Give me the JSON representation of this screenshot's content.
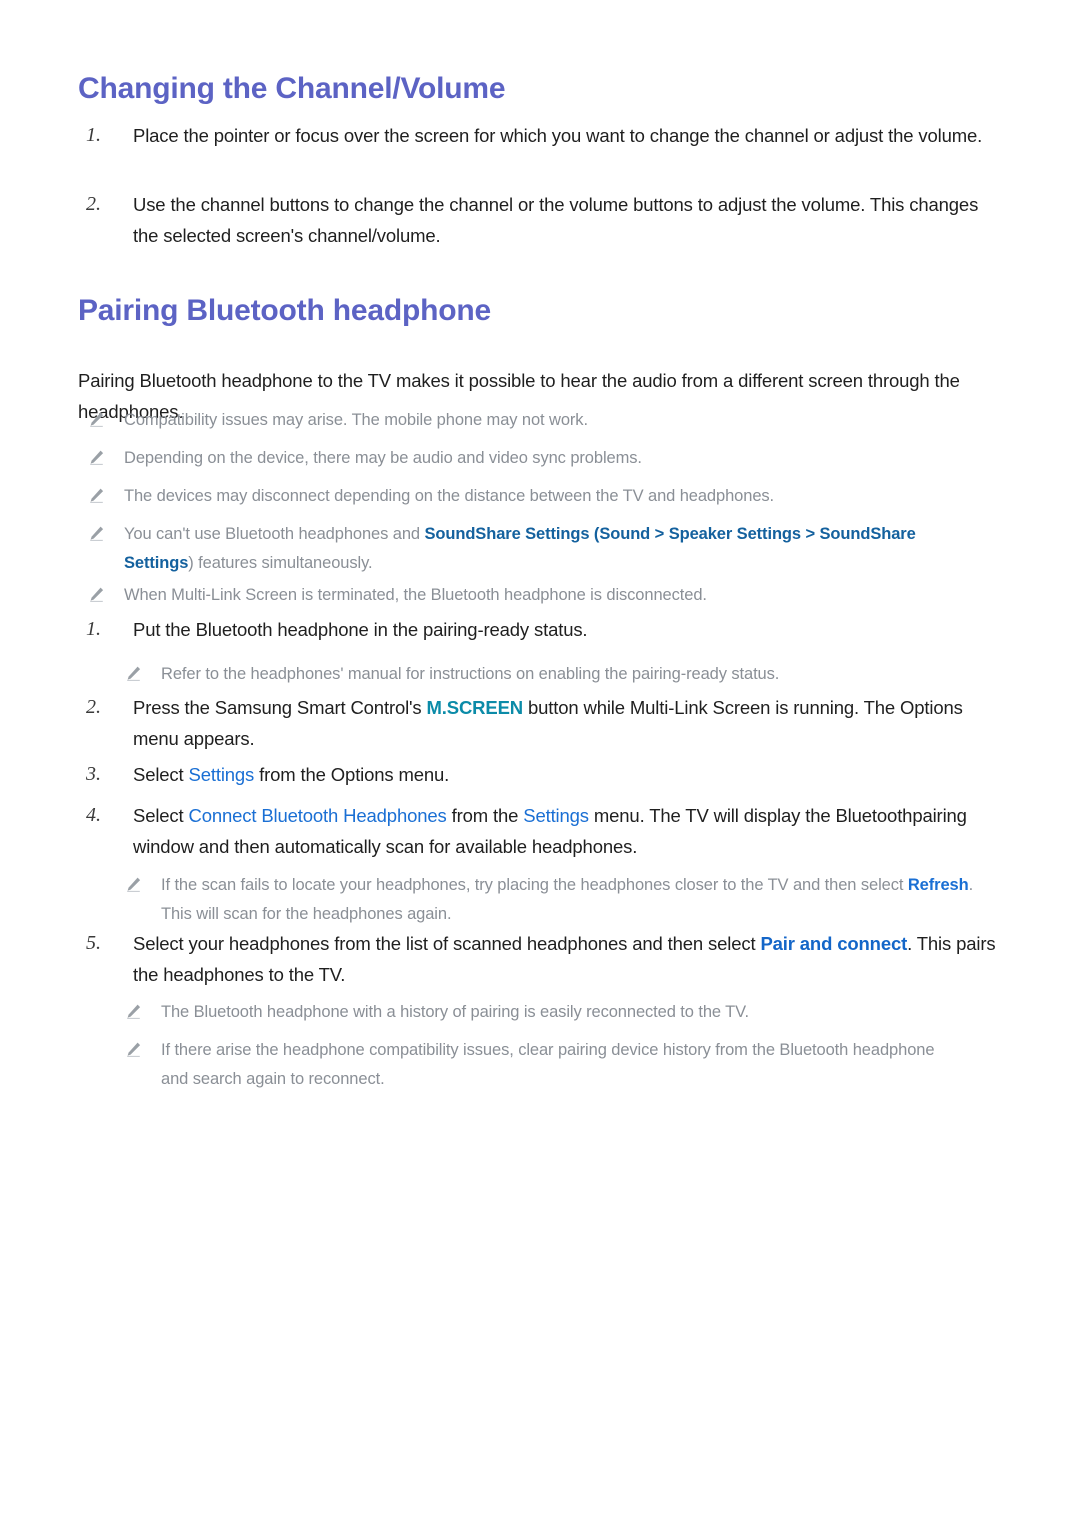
{
  "document": {
    "title": "Changing the Channel/Volume"
  },
  "colors": {
    "heading": "#5c63c4",
    "blue_bold": "#14619e",
    "blue_link": "#1a6fd4",
    "teal": "#0b8ba8",
    "note_gray": "#8a8f96",
    "body": "#1f1f1f"
  },
  "sections": [
    {
      "heading": "Changing the Channel/Volume",
      "steps": [
        {
          "number": "1.",
          "text": "Place the pointer or focus over the screen for which you want to change the channel or adjust the volume."
        },
        {
          "number": "2.",
          "text": "Use the channel buttons to change the channel or the volume buttons to adjust the volume. This changes the selected screen's channel/volume."
        }
      ]
    },
    {
      "heading": "Pairing Bluetooth headphone",
      "intro": "Pairing Bluetooth headphone to the TV makes it possible to hear the audio from a different screen through the headphones.",
      "notes_top": [
        {
          "icon": "pencil-icon",
          "text": "Compatibility issues may arise. The mobile phone may not work."
        },
        {
          "icon": "pencil-icon",
          "text": "Depending on the device, there may be audio and video sync problems."
        },
        {
          "icon": "pencil-icon",
          "text": "The devices may disconnect depending on the distance between the TV and headphones."
        },
        {
          "icon": "pencil-icon",
          "rich": {
            "lead": "You can't use Bluetooth headphones and ",
            "t1": "SoundShare Settings",
            "open_paren": " (",
            "t2": "Sound",
            "chev1": " > ",
            "t3": "Speaker Settings",
            "chev2": " > ",
            "t4": "SoundShare Settings",
            "tail": ") features simultaneously."
          }
        },
        {
          "icon": "pencil-icon",
          "text": "When Multi-Link Screen is terminated, the Bluetooth headphone is disconnected."
        }
      ],
      "steps": [
        {
          "number": "1.",
          "text": "Put the Bluetooth headphone in the pairing-ready status.",
          "subnotes": [
            {
              "icon": "pencil-icon",
              "text": "Refer to the headphones' manual for instructions on enabling the pairing-ready status."
            }
          ]
        },
        {
          "number": "2.",
          "rich": {
            "lead": "Press the Samsung Smart Control's ",
            "key": "M.SCREEN",
            "tail": " button while Multi-Link Screen is running. The Options menu appears."
          }
        },
        {
          "number": "3.",
          "rich": {
            "lead": "Select ",
            "t1": "Settings",
            "tail": " from the Options menu."
          }
        },
        {
          "number": "4.",
          "rich": {
            "lead": "Select ",
            "t1": "Connect Bluetooth Headphones",
            "mid": " from the ",
            "t2": "Settings",
            "tail": " menu. The TV will display the Bluetoothpairing window and then automatically scan for available headphones."
          },
          "subnotes": [
            {
              "icon": "pencil-icon",
              "rich": {
                "lead": "If the scan fails to locate your headphones, try placing the headphones closer to the TV and then select ",
                "t1": "Refresh",
                "tail": ". This will scan for the headphones again."
              }
            }
          ]
        },
        {
          "number": "5.",
          "rich": {
            "lead": "Select your headphones from the list of scanned headphones and then select ",
            "t1": "Pair and connect",
            "tail": ". This pairs the headphones to the TV."
          },
          "subnotes": [
            {
              "icon": "pencil-icon",
              "text": "The Bluetooth headphone with a history of pairing is easily reconnected to the TV."
            },
            {
              "icon": "pencil-icon",
              "text": "If there arise the headphone compatibility issues, clear pairing device history from the Bluetooth headphone and search again to reconnect."
            }
          ]
        }
      ]
    }
  ]
}
